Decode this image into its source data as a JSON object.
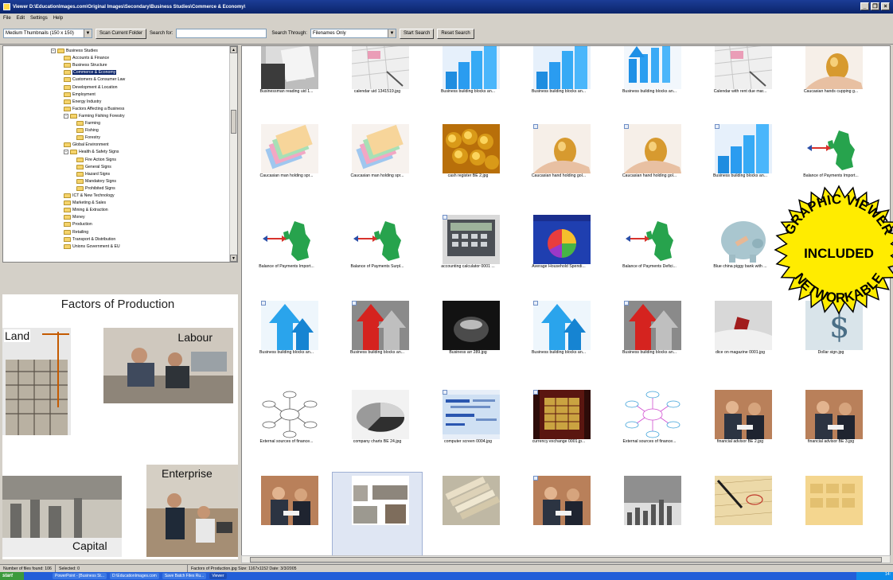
{
  "window": {
    "title": "Viewer D:\\EducationImages.com\\Original Images\\Secondary\\Business Studies\\Commerce & Economy\\"
  },
  "menu": [
    "File",
    "Edit",
    "Settings",
    "Help"
  ],
  "toolbar": {
    "thumb_size": "Medium Thumbnails (150 x 150)",
    "scan_label": "Scan Current Folder",
    "search_for_label": "Search for:",
    "search_value": "",
    "search_through_label": "Search Through:",
    "search_through_value": "Filenames Only",
    "start_search_label": "Start Search",
    "reset_search_label": "Reset Search"
  },
  "tree": [
    {
      "label": "Business Studies",
      "level": 0,
      "expanded": true
    },
    {
      "label": "Accounts & Finance",
      "level": 1
    },
    {
      "label": "Business Structure",
      "level": 1
    },
    {
      "label": "Commerce & Economy",
      "level": 1,
      "selected": true
    },
    {
      "label": "Customers & Consumer Law",
      "level": 1
    },
    {
      "label": "Development & Location",
      "level": 1
    },
    {
      "label": "Employment",
      "level": 1
    },
    {
      "label": "Energy Industry",
      "level": 1
    },
    {
      "label": "Factors Affecting a Business",
      "level": 1
    },
    {
      "label": "Farming Fishing Forestry",
      "level": 1,
      "expanded": true
    },
    {
      "label": "Farming",
      "level": 2
    },
    {
      "label": "Fishing",
      "level": 2
    },
    {
      "label": "Forestry",
      "level": 2
    },
    {
      "label": "Global Environment",
      "level": 1
    },
    {
      "label": "Health & Safety Signs",
      "level": 1,
      "expanded": true
    },
    {
      "label": "Fire Action Signs",
      "level": 2
    },
    {
      "label": "General Signs",
      "level": 2
    },
    {
      "label": "Hazard Signs",
      "level": 2
    },
    {
      "label": "Mandatory Signs",
      "level": 2
    },
    {
      "label": "Prohibited Signs",
      "level": 2
    },
    {
      "label": "ICT & New Technology",
      "level": 1
    },
    {
      "label": "Marketing & Sales",
      "level": 1
    },
    {
      "label": "Mining & Extraction",
      "level": 1
    },
    {
      "label": "Money",
      "level": 1
    },
    {
      "label": "Production",
      "level": 1
    },
    {
      "label": "Retailing",
      "level": 1
    },
    {
      "label": "Transport & Distribution",
      "level": 1
    },
    {
      "label": "Unions Government & EU",
      "level": 1
    }
  ],
  "preview": {
    "title": "Factors of Production",
    "labels": [
      "Land",
      "Labour",
      "Enterprise",
      "Capital"
    ]
  },
  "thumbnails": [
    {
      "caption": "Businessman reading uid 1...",
      "kind": "paper",
      "badge": false
    },
    {
      "caption": "calendar uid 1341519.jpg",
      "kind": "calendar",
      "badge": false
    },
    {
      "caption": "Business building blocks an...",
      "kind": "blue-blocks",
      "badge": false
    },
    {
      "caption": "Business building blocks an...",
      "kind": "blue-blocks",
      "badge": false
    },
    {
      "caption": "Business building blocks an...",
      "kind": "blue-bars",
      "badge": false
    },
    {
      "caption": "Calendar with rent due mar...",
      "kind": "calendar",
      "badge": false
    },
    {
      "caption": "Caucasian hands cupping g...",
      "kind": "gold-egg",
      "badge": false
    },
    {
      "caption": "Caucasian man holding spr...",
      "kind": "cards",
      "badge": false
    },
    {
      "caption": "Caucasian man holding spr...",
      "kind": "cards",
      "badge": false
    },
    {
      "caption": "cash register BE 2.jpg",
      "kind": "coins",
      "badge": false
    },
    {
      "caption": "Caucasian hand holding gol...",
      "kind": "gold-egg",
      "badge": true
    },
    {
      "caption": "Caucasian hand holding gol...",
      "kind": "gold-egg",
      "badge": true
    },
    {
      "caption": "Business building blocks an...",
      "kind": "blue-blocks",
      "badge": true
    },
    {
      "caption": "Balance of Payments Import...",
      "kind": "uk-map",
      "badge": false
    },
    {
      "caption": "Balance of Payments Import...",
      "kind": "uk-map",
      "badge": false
    },
    {
      "caption": "Balance of Payments Surpl...",
      "kind": "uk-map",
      "badge": false
    },
    {
      "caption": "accounting calculator 0001 ...",
      "kind": "calculator",
      "badge": true
    },
    {
      "caption": "Average Household Spendi...",
      "kind": "pie",
      "badge": false
    },
    {
      "caption": "Balance of Payments Defici...",
      "kind": "uk-map",
      "badge": false
    },
    {
      "caption": "Blue china piggy bank with ...",
      "kind": "piggy",
      "badge": false
    },
    {
      "caption": "",
      "kind": "blank",
      "badge": false
    },
    {
      "caption": "Business building blocks an...",
      "kind": "blue-arrow",
      "badge": true
    },
    {
      "caption": "Business building blocks an...",
      "kind": "red-arrow",
      "badge": true
    },
    {
      "caption": "Business arr 289.jpg",
      "kind": "dark",
      "badge": false
    },
    {
      "caption": "Business building blocks an...",
      "kind": "blue-arrow",
      "badge": true
    },
    {
      "caption": "Business building blocks an...",
      "kind": "red-arrow",
      "badge": true
    },
    {
      "caption": "dice on magazine 0001.jpg",
      "kind": "dice",
      "badge": false
    },
    {
      "caption": "Dollar sign.jpg",
      "kind": "dollar",
      "badge": false
    },
    {
      "caption": "External sources of finance...",
      "kind": "mindmap",
      "badge": false
    },
    {
      "caption": "company charts BE 24.jpg",
      "kind": "pie-grey",
      "badge": false
    },
    {
      "caption": "computer screen 0004.jpg",
      "kind": "screen",
      "badge": true
    },
    {
      "caption": "currency exchange 0001.jp...",
      "kind": "exchange",
      "badge": true
    },
    {
      "caption": "External sources of finance...",
      "kind": "mindmap-pink",
      "badge": false
    },
    {
      "caption": "financial advisor BE 2.jpg",
      "kind": "people",
      "badge": false
    },
    {
      "caption": "financial advisor BE 3.jpg",
      "kind": "people",
      "badge": false
    },
    {
      "caption": "",
      "kind": "people",
      "badge": false
    },
    {
      "caption": "",
      "kind": "factors",
      "badge": false
    },
    {
      "caption": "",
      "kind": "paper-stack",
      "badge": false
    },
    {
      "caption": "",
      "kind": "people",
      "badge": true
    },
    {
      "caption": "",
      "kind": "bars-grey",
      "badge": false
    },
    {
      "caption": "",
      "kind": "pen",
      "badge": false
    },
    {
      "caption": "",
      "kind": "calc-gold",
      "badge": false
    }
  ],
  "status": {
    "files_found": "Number of files found: 106",
    "selected": "Selected: 0",
    "file_info": "Factors of Production.jpg   Size: 1167x1152   Date: 3/3/2005"
  },
  "taskbar": {
    "start": "start",
    "tasks": [
      "PowerPoint - [Business St...",
      "D:\\EducationImages.com",
      "Save Batch Files Ru...",
      "Viewer"
    ],
    "clock": "14:"
  },
  "seal": {
    "line1": "GRAPHIC VIEWER",
    "line2": "INCLUDED",
    "line3": "NETWORKABLE",
    "color": "#ffec00"
  }
}
